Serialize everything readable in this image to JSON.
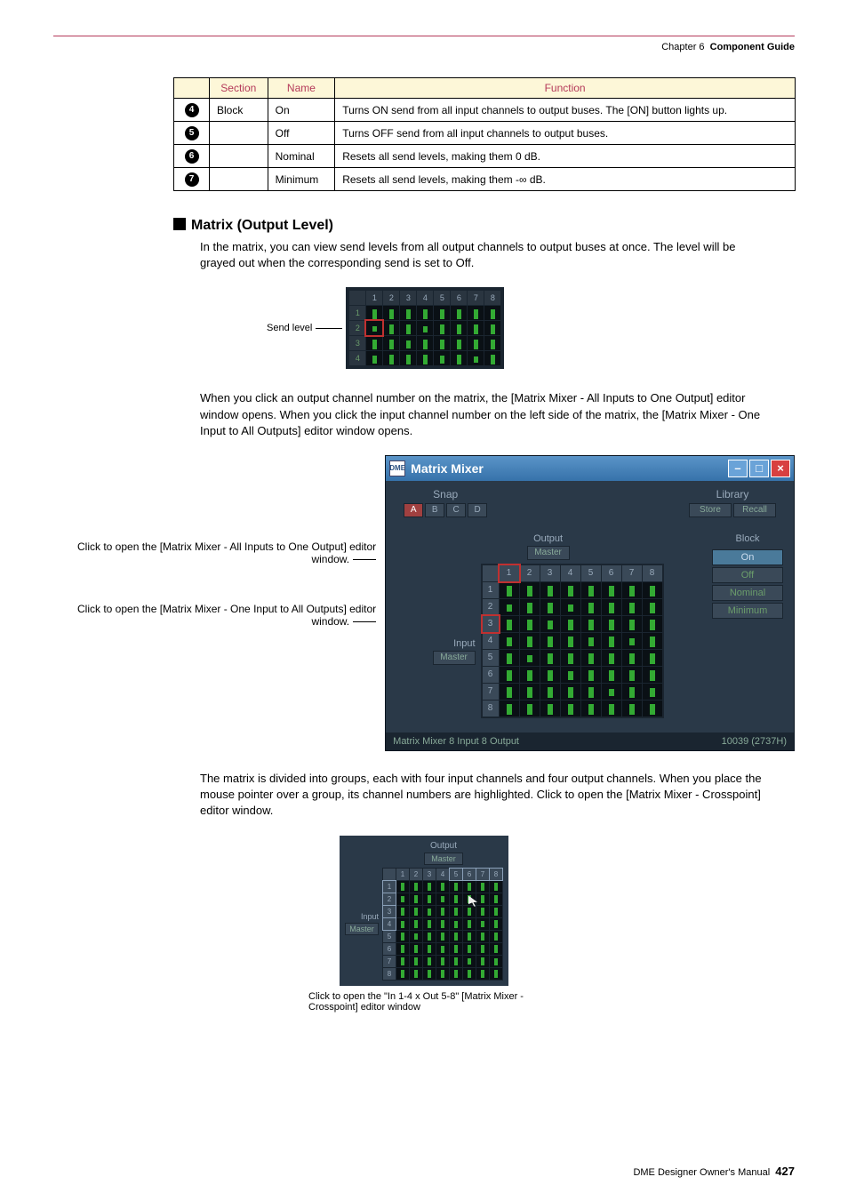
{
  "breadcrumb": {
    "chapter": "Chapter 6",
    "title": "Component Guide"
  },
  "table": {
    "headers": [
      "Section",
      "Name",
      "Function"
    ],
    "rows": [
      {
        "num": "4",
        "section": "Block",
        "name": "On",
        "func": "Turns ON send from all input channels to output buses. The [ON] button lights up."
      },
      {
        "num": "5",
        "section": "",
        "name": "Off",
        "func": "Turns OFF send from all input channels to output buses."
      },
      {
        "num": "6",
        "section": "",
        "name": "Nominal",
        "func": "Resets all send levels, making them 0 dB."
      },
      {
        "num": "7",
        "section": "",
        "name": "Minimum",
        "func": "Resets all send levels, making them -∞ dB."
      }
    ]
  },
  "section1": {
    "title": "Matrix (Output Level)",
    "p1": "In the matrix, you can view send levels from all output channels to output buses at once. The level will be grayed out when the corresponding send is set to Off.",
    "send_label": "Send level",
    "cols": [
      "1",
      "2",
      "3",
      "4",
      "5",
      "6",
      "7",
      "8"
    ],
    "rows": [
      "1",
      "2",
      "3",
      "4"
    ],
    "heights": [
      [
        11,
        11,
        11,
        11,
        11,
        11,
        11,
        11
      ],
      [
        6,
        11,
        11,
        7,
        11,
        11,
        11,
        11
      ],
      [
        11,
        11,
        9,
        11,
        11,
        11,
        11,
        11
      ],
      [
        9,
        11,
        11,
        11,
        9,
        11,
        7,
        11
      ]
    ],
    "p2": "When you click an output channel number on the matrix, the [Matrix Mixer - All Inputs to One Output] editor window opens. When you click the input channel number on the left side of the matrix, the [Matrix Mixer - One Input to All Outputs] editor window opens."
  },
  "mixer_labels": {
    "a": "Click to open the [Matrix Mixer - All Inputs to One Output] editor window.",
    "b": "Click to open the [Matrix Mixer - One Input to All Outputs] editor window."
  },
  "mixer": {
    "icon": "DME",
    "title": "Matrix Mixer",
    "win_min": "–",
    "win_max": "□",
    "win_close": "×",
    "snap_label": "Snap",
    "snaps": [
      "A",
      "B",
      "C",
      "D"
    ],
    "lib_label": "Library",
    "store": "Store",
    "recall": "Recall",
    "output_label": "Output",
    "output_btn": "Master",
    "input_label": "Input",
    "input_btn": "Master",
    "cols": [
      "1",
      "2",
      "3",
      "4",
      "5",
      "6",
      "7",
      "8"
    ],
    "rows": [
      "1",
      "2",
      "3",
      "4",
      "5",
      "6",
      "7",
      "8"
    ],
    "heights": [
      [
        12,
        12,
        12,
        12,
        12,
        12,
        12,
        12
      ],
      [
        8,
        12,
        12,
        8,
        12,
        12,
        12,
        12
      ],
      [
        12,
        12,
        10,
        12,
        12,
        12,
        12,
        12
      ],
      [
        10,
        12,
        12,
        12,
        10,
        12,
        8,
        12
      ],
      [
        12,
        8,
        12,
        12,
        12,
        12,
        12,
        12
      ],
      [
        12,
        12,
        12,
        10,
        12,
        12,
        12,
        12
      ],
      [
        12,
        12,
        12,
        12,
        12,
        8,
        12,
        10
      ],
      [
        12,
        12,
        12,
        12,
        12,
        12,
        12,
        12
      ]
    ],
    "block_label": "Block",
    "block_btns": [
      "On",
      "Off",
      "Nominal",
      "Minimum"
    ],
    "status_left": "Matrix Mixer  8 Input 8 Output",
    "status_right": "10039 (2737H)"
  },
  "section2": {
    "p": "The matrix is divided into groups, each with four input channels and four output channels. When you place the mouse pointer over a group, its channel numbers are highlighted. Click to open the [Matrix Mixer - Crosspoint] editor window."
  },
  "cross": {
    "out_label": "Output",
    "out_btn": "Master",
    "in_label": "Input",
    "in_btn": "Master",
    "cols": [
      "1",
      "2",
      "3",
      "4",
      "5",
      "6",
      "7",
      "8"
    ],
    "rows": [
      "1",
      "2",
      "3",
      "4",
      "5",
      "6",
      "7",
      "8"
    ],
    "heights": [
      [
        9,
        9,
        9,
        9,
        9,
        9,
        9,
        9
      ],
      [
        7,
        9,
        9,
        7,
        9,
        9,
        9,
        9
      ],
      [
        9,
        9,
        8,
        9,
        9,
        9,
        9,
        9
      ],
      [
        8,
        9,
        9,
        9,
        8,
        9,
        7,
        9
      ],
      [
        9,
        7,
        9,
        9,
        9,
        9,
        9,
        9
      ],
      [
        9,
        9,
        9,
        8,
        9,
        9,
        9,
        9
      ],
      [
        9,
        9,
        9,
        9,
        9,
        7,
        9,
        8
      ],
      [
        9,
        9,
        9,
        9,
        9,
        9,
        9,
        9
      ]
    ],
    "caption": "Click to open the \"In 1-4 x Out 5-8\" [Matrix Mixer - Crosspoint] editor window"
  },
  "footer": {
    "text": "DME Designer Owner's Manual",
    "page": "427"
  }
}
